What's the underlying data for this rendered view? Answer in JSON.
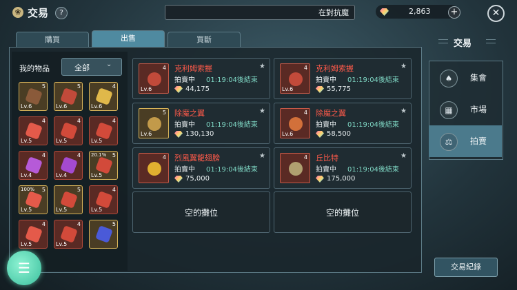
{
  "header": {
    "title": "交易",
    "help_label": "?",
    "status_text": "在對抗魔",
    "currency_amount": "2,863",
    "plus_label": "+",
    "close_label": "✕"
  },
  "tabs": [
    {
      "label": "購買",
      "active": false
    },
    {
      "label": "出售",
      "active": true
    },
    {
      "label": "買斷",
      "active": false
    }
  ],
  "inventory": {
    "title": "我的物品",
    "filter_value": "全部",
    "slots": [
      {
        "stars": "5",
        "level": "Lv.6",
        "style": "gold",
        "color": "#8a5a3a",
        "pct": ""
      },
      {
        "stars": "5",
        "level": "Lv.6",
        "style": "gold",
        "color": "#c24a3a",
        "pct": ""
      },
      {
        "stars": "4",
        "level": "Lv.6",
        "style": "gold",
        "color": "#e0b84a",
        "pct": ""
      },
      {
        "stars": "4",
        "level": "Lv.5",
        "style": "red",
        "color": "#e45a4a",
        "pct": ""
      },
      {
        "stars": "4",
        "level": "Lv.5",
        "style": "red",
        "color": "#d24a3a",
        "pct": ""
      },
      {
        "stars": "4",
        "level": "Lv.5",
        "style": "red",
        "color": "#d24a3a",
        "pct": ""
      },
      {
        "stars": "4",
        "level": "Lv.4",
        "style": "red",
        "color": "#b65ad8",
        "pct": ""
      },
      {
        "stars": "4",
        "level": "Lv.4",
        "style": "red",
        "color": "#a44ad0",
        "pct": ""
      },
      {
        "stars": "5",
        "level": "Lv.5",
        "style": "gold",
        "color": "#d24a3a",
        "pct": "20.1%"
      },
      {
        "stars": "5",
        "level": "Lv.5",
        "style": "gold",
        "color": "#e45a4a",
        "pct": "100%"
      },
      {
        "stars": "5",
        "level": "Lv.5",
        "style": "gold",
        "color": "#d24a3a",
        "pct": ""
      },
      {
        "stars": "4",
        "level": "Lv.5",
        "style": "red",
        "color": "#d24a3a",
        "pct": ""
      },
      {
        "stars": "4",
        "level": "Lv.5",
        "style": "red",
        "color": "#e45a4a",
        "pct": ""
      },
      {
        "stars": "4",
        "level": "Lv.5",
        "style": "red",
        "color": "#d24a3a",
        "pct": ""
      },
      {
        "stars": "5",
        "level": "",
        "style": "gold",
        "color": "#4a5ad8",
        "pct": ""
      }
    ]
  },
  "listings": [
    {
      "name": "克利姆索握",
      "stars": "4",
      "level": "Lv.6",
      "status": "拍賣中",
      "time": "01:19:04後結束",
      "price": "44,175",
      "style": "red",
      "color": "#c24a3a"
    },
    {
      "name": "克利姆索握",
      "stars": "4",
      "level": "Lv.6",
      "status": "拍賣中",
      "time": "01:19:04後結束",
      "price": "55,775",
      "style": "red",
      "color": "#c24a3a"
    },
    {
      "name": "除魔之翼",
      "stars": "5",
      "level": "Lv.6",
      "status": "拍賣中",
      "time": "01:19:04後結束",
      "price": "130,130",
      "style": "gold",
      "color": "#c29a4a"
    },
    {
      "name": "除魔之翼",
      "stars": "4",
      "level": "Lv.6",
      "status": "拍賣中",
      "time": "01:19:04後結束",
      "price": "58,500",
      "style": "red",
      "color": "#d2703a"
    },
    {
      "name": "烈風翼龍翅膀",
      "stars": "4",
      "level": "",
      "status": "拍賣中",
      "time": "01:19:04後結束",
      "price": "75,000",
      "style": "red",
      "color": "#e0b030"
    },
    {
      "name": "丘比特",
      "stars": "4",
      "level": "",
      "status": "拍賣中",
      "time": "01:19:04後結束",
      "price": "175,000",
      "style": "red",
      "color": "#b0a070"
    }
  ],
  "empty_slots": [
    {
      "label": "空的攤位"
    },
    {
      "label": "空的攤位"
    }
  ],
  "sidebar": {
    "title": "交易",
    "items": [
      {
        "label": "集會",
        "icon": "bag-icon",
        "glyph": "♠"
      },
      {
        "label": "市場",
        "icon": "market-icon",
        "glyph": "▦"
      },
      {
        "label": "拍賣",
        "icon": "scale-icon",
        "glyph": "⚖"
      }
    ],
    "history_label": "交易紀錄"
  },
  "fab_glyph": "☰",
  "colors": {
    "accent": "#4f8aa0",
    "name_red": "#ff5a4a",
    "timer_teal": "#7fd7c4"
  }
}
